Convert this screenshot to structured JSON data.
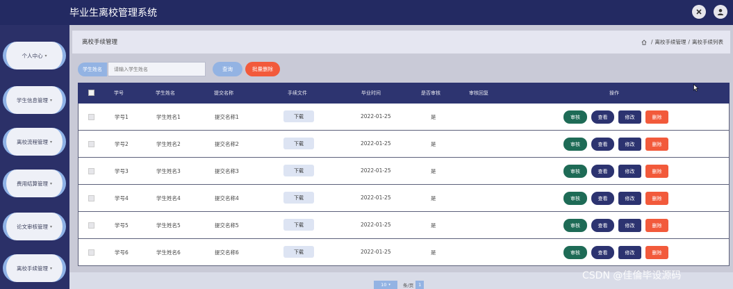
{
  "app": {
    "title": "毕业生离校管理系统"
  },
  "header_icons": {
    "close": "close-icon",
    "user": "user-icon"
  },
  "sidebar": {
    "items": [
      {
        "label": "个人中心"
      },
      {
        "label": "学生信息管理"
      },
      {
        "label": "离校流程管理"
      },
      {
        "label": "费用结算管理"
      },
      {
        "label": "论文审核管理"
      },
      {
        "label": "离校手续管理"
      }
    ]
  },
  "page": {
    "title": "离校手续管理",
    "breadcrumb": [
      "离校手续管理",
      "离校手续列表"
    ]
  },
  "search": {
    "label": "学生姓名",
    "placeholder": "请输入学生姓名",
    "query_label": "查询",
    "batch_delete_label": "批量删除"
  },
  "table": {
    "columns": [
      "学号",
      "学生姓名",
      "提交名称",
      "手续文件",
      "毕业时间",
      "是否审核",
      "审核回复",
      "操作"
    ],
    "rows": [
      {
        "student_id": "学号1",
        "name": "学生姓名1",
        "submit_name": "提交名称1",
        "file": "下载",
        "grad_date": "2022-01-25",
        "audited": "是",
        "reply": ""
      },
      {
        "student_id": "学号2",
        "name": "学生姓名2",
        "submit_name": "提交名称2",
        "file": "下载",
        "grad_date": "2022-01-25",
        "audited": "是",
        "reply": ""
      },
      {
        "student_id": "学号3",
        "name": "学生姓名3",
        "submit_name": "提交名称3",
        "file": "下载",
        "grad_date": "2022-01-25",
        "audited": "是",
        "reply": ""
      },
      {
        "student_id": "学号4",
        "name": "学生姓名4",
        "submit_name": "提交名称4",
        "file": "下载",
        "grad_date": "2022-01-25",
        "audited": "是",
        "reply": ""
      },
      {
        "student_id": "学号5",
        "name": "学生姓名5",
        "submit_name": "提交名称5",
        "file": "下载",
        "grad_date": "2022-01-25",
        "audited": "是",
        "reply": ""
      },
      {
        "student_id": "学号6",
        "name": "学生姓名6",
        "submit_name": "提交名称6",
        "file": "下载",
        "grad_date": "2022-01-25",
        "audited": "是",
        "reply": ""
      }
    ],
    "actions": {
      "audit": "审核",
      "view": "查看",
      "edit": "修改",
      "delete": "删除"
    }
  },
  "pagination": {
    "page_size": "10",
    "page_size_suffix": "条/页",
    "current_page": "1"
  },
  "watermark": "CSDN @佳倫毕设源码",
  "colors": {
    "header_bg": "#232a62",
    "table_header_bg": "#2d3470",
    "accent_blue": "#93b3e3",
    "danger": "#f25a3b",
    "audit_green": "#1e6b56"
  }
}
